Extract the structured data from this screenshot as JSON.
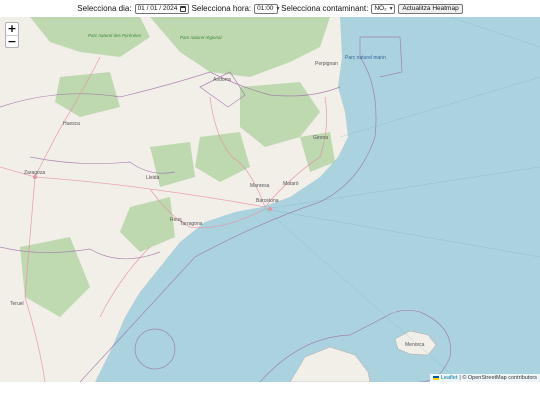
{
  "controls": {
    "day_label": "Selecciona dia:",
    "day_value": "01 / 01 / 2024",
    "hour_label": "Selecciona hora:",
    "hour_value": "01:00",
    "pollutant_label": "Selecciona contaminant:",
    "pollutant_value": "NO₂",
    "update_button": "Actualitza Heatmap"
  },
  "map": {
    "zoom_in": "+",
    "zoom_out": "−",
    "attribution_leaflet": "Leaflet",
    "attribution_rest": "| © OpenStreetMap contributors",
    "places": [
      "Andorra",
      "Zaragoza",
      "Barcelona",
      "Lleida",
      "Girona",
      "Tarragona",
      "Reus",
      "Huesca",
      "Manresa",
      "Mataró",
      "Menorca",
      "Teruel",
      "Perpignan"
    ],
    "parks": [
      "Parc naturel des Pyrénées",
      "Parc naturel régional",
      "Parc naturel marin"
    ],
    "colors": {
      "sea": "#aad3df",
      "land": "#f2efe9",
      "forest": "#add19e",
      "border": "#9e6fa3",
      "road": "#e892a2"
    }
  }
}
